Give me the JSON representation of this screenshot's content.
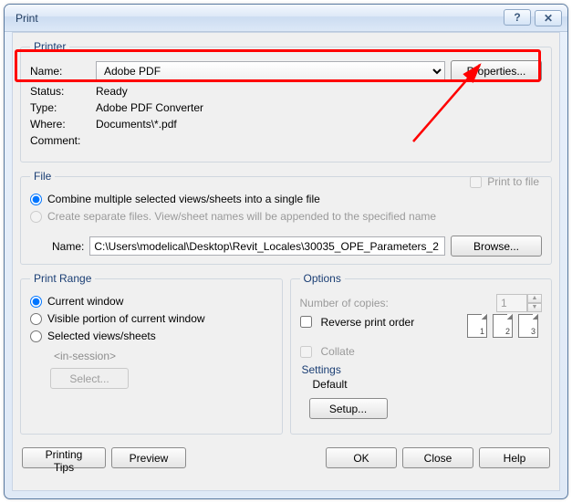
{
  "window": {
    "title": "Print"
  },
  "titlebarButtons": {
    "help": "?",
    "close": "✕"
  },
  "printer": {
    "legend": "Printer",
    "nameLabel": "Name:",
    "selected": "Adobe PDF",
    "propertiesLabel": "Properties...",
    "statusLabel": "Status:",
    "statusValue": "Ready",
    "typeLabel": "Type:",
    "typeValue": "Adobe PDF Converter",
    "whereLabel": "Where:",
    "whereValue": "Documents\\*.pdf",
    "commentLabel": "Comment:",
    "printToFileLabel": "Print to file"
  },
  "file": {
    "legend": "File",
    "combineLabel": "Combine multiple selected views/sheets into a single file",
    "separateLabel": "Create separate files. View/sheet names will be appended to the specified name",
    "nameLabel": "Name:",
    "path": "C:\\Users\\modelical\\Desktop\\Revit_Locales\\30035_OPE_Parameters_2",
    "browseLabel": "Browse..."
  },
  "printRange": {
    "legend": "Print Range",
    "currentWindow": "Current window",
    "visiblePortion": "Visible portion of current window",
    "selectedViews": "Selected views/sheets",
    "inSession": "<in-session>",
    "selectLabel": "Select..."
  },
  "options": {
    "legend": "Options",
    "copiesLabel": "Number of copies:",
    "copiesValue": "1",
    "reverseLabel": "Reverse print order",
    "collateLabel": "Collate",
    "settingsHead": "Settings",
    "settingsDefault": "Default",
    "setupLabel": "Setup..."
  },
  "bottom": {
    "tips": "Printing Tips",
    "preview": "Preview",
    "ok": "OK",
    "close": "Close",
    "help": "Help"
  },
  "collateNumbers": [
    "1",
    "2",
    "3"
  ]
}
